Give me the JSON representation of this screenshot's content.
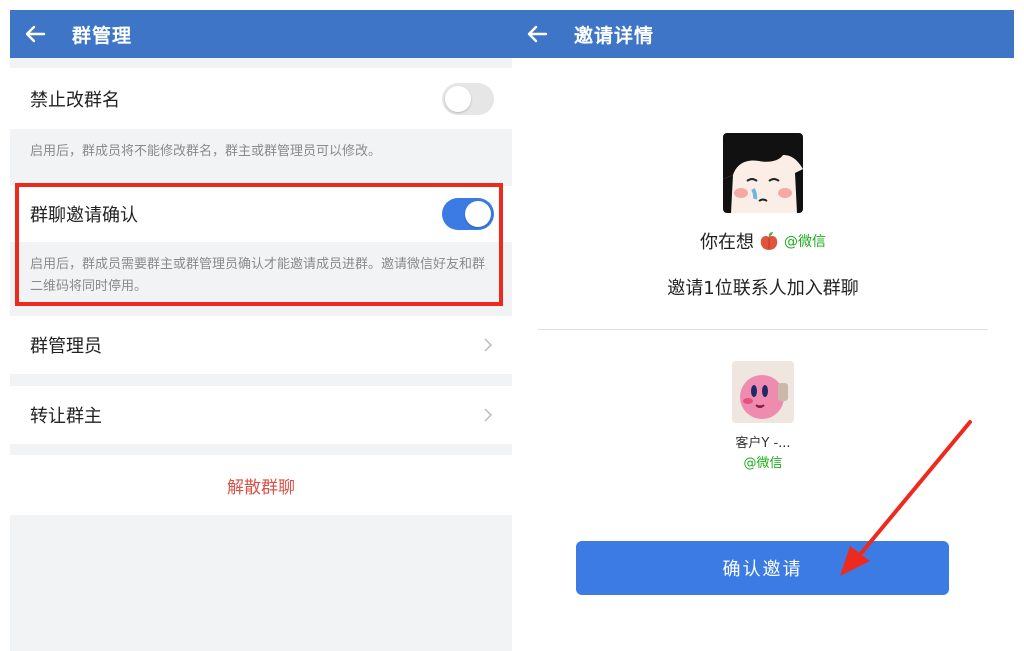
{
  "left_panel": {
    "header": {
      "title": "群管理",
      "back_icon": "back-arrow-icon"
    },
    "rows": {
      "forbid_rename": {
        "label": "禁止改群名",
        "toggle": "off"
      },
      "forbid_rename_desc": "启用后，群成员将不能修改群名，群主或群管理员可以修改。",
      "invite_confirm": {
        "label": "群聊邀请确认",
        "toggle": "on"
      },
      "invite_confirm_desc": "启用后，群成员需要群主或群管理员确认才能邀请成员进群。邀请微信好友和群二维码将同时停用。",
      "admins": {
        "label": "群管理员"
      },
      "transfer_owner": {
        "label": "转让群主"
      },
      "dissolve": {
        "label": "解散群聊"
      }
    }
  },
  "right_panel": {
    "header": {
      "title": "邀请详情",
      "back_icon": "back-arrow-icon"
    },
    "inviter": {
      "name": "你在想",
      "emoji": "peach-icon",
      "tag": "@微信"
    },
    "invite_text": "邀请1位联系人加入群聊",
    "member": {
      "name": "客户Y -...",
      "tag": "@微信"
    },
    "confirm_button": "确认邀请"
  },
  "colors": {
    "header_bg": "#3e75c7",
    "toggle_on": "#3b7be3",
    "highlight_border": "#ee2a1f",
    "wechat_green": "#1aad19",
    "dissolve_red": "#d9534a"
  }
}
